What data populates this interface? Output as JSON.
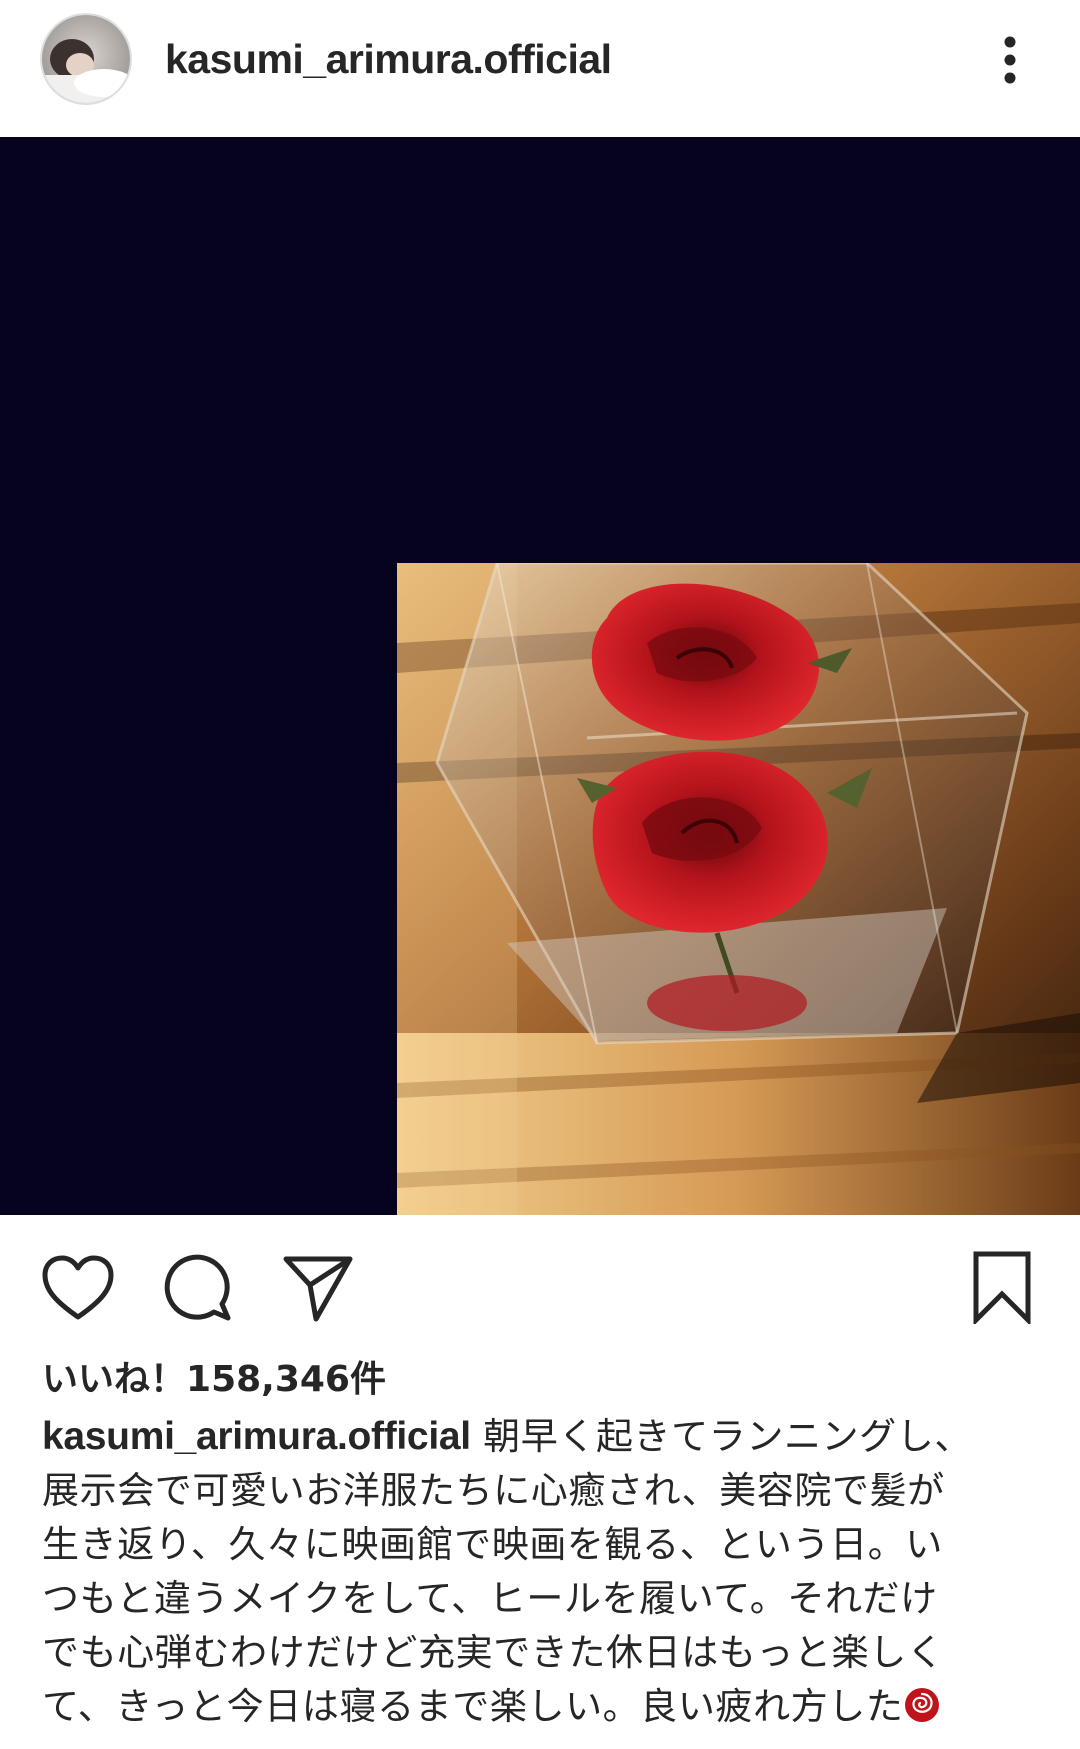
{
  "header": {
    "username": "kasumi_arimura.official",
    "more_icon": "more-vertical-icon"
  },
  "post": {
    "likes_label": "いいね！",
    "likes_count": "158,346",
    "likes_suffix": "件",
    "caption_user": "kasumi_arimura.official",
    "caption_lines": [
      " 朝早く起きてランニングし、",
      "展示会で可愛いお洋服たちに心癒され、美容院で髪が",
      "生き返り、久々に映画館で映画を観る、という日。い",
      "つもと違うメイクをして、ヒールを履いて。それだけ",
      "でも心弾むわけだけど充実できた休日はもっと楽しく",
      "て、きっと今日は寝るまで楽しい。良い疲れ方した"
    ],
    "caption_emoji": "rose-emoji"
  },
  "actions": {
    "like_icon": "heart-icon",
    "comment_icon": "comment-icon",
    "share_icon": "send-icon",
    "save_icon": "bookmark-icon"
  },
  "colors": {
    "media_background": "#05031e",
    "text": "#262626",
    "rose": "#c0141c"
  }
}
